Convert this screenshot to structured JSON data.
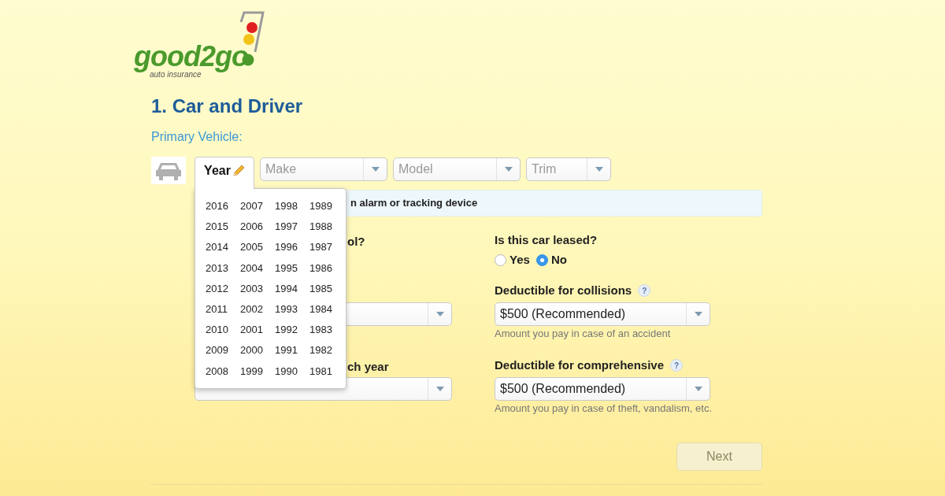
{
  "logo": {
    "name": "good2go",
    "tagline": "auto insurance"
  },
  "step_title": "1. Car and Driver",
  "section_label": "Primary Vehicle:",
  "vehicle_fields": [
    {
      "kind": "tab",
      "label": "Year",
      "expanded": true
    },
    {
      "kind": "select",
      "placeholder": "Make"
    },
    {
      "kind": "select",
      "placeholder": "Model"
    },
    {
      "kind": "select",
      "placeholder": "Trim"
    }
  ],
  "year_menu": [
    [
      "2016",
      "2015",
      "2014",
      "2013",
      "2012",
      "2011",
      "2010",
      "2009",
      "2008"
    ],
    [
      "2007",
      "2006",
      "2005",
      "2004",
      "2003",
      "2002",
      "2001",
      "2000",
      "1999"
    ],
    [
      "1998",
      "1997",
      "1996",
      "1995",
      "1994",
      "1993",
      "1992",
      "1991",
      "1990"
    ],
    [
      "1989",
      "1988",
      "1987",
      "1986",
      "1985",
      "1984",
      "1983",
      "1982",
      "1981"
    ]
  ],
  "info_bar": {
    "text": "n alarm or tracking device"
  },
  "left_column": [
    {
      "kind": "label",
      "text": "ol?"
    },
    {
      "kind": "select"
    },
    {
      "kind": "label",
      "text": "ch year"
    },
    {
      "kind": "select"
    }
  ],
  "leased": {
    "label": "Is this car leased?",
    "options": [
      {
        "label": "Yes",
        "selected": false
      },
      {
        "label": "No",
        "selected": true
      }
    ]
  },
  "deductibles": [
    {
      "label": "Deductible for collisions",
      "help": "?",
      "value": "$500 (Recommended)",
      "hint": "Amount you pay in case of an accident"
    },
    {
      "label": "Deductible for comprehensive",
      "help": "?",
      "value": "$500 (Recommended)",
      "hint": "Amount you pay in case of theft, vandalism, etc."
    }
  ],
  "next_button": {
    "label": "Next",
    "disabled": true
  }
}
